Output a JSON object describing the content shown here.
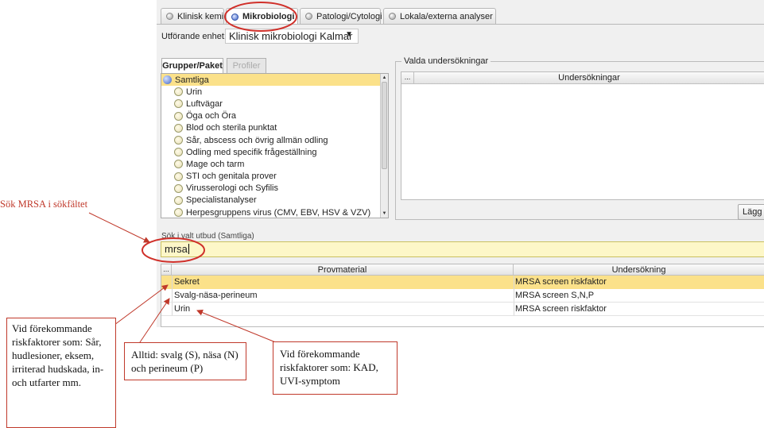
{
  "tabs": [
    {
      "label": "Klinisk kemi",
      "active": false
    },
    {
      "label": "Mikrobiologi",
      "active": true
    },
    {
      "label": "Patologi/Cytologi",
      "active": false
    },
    {
      "label": "Lokala/externa analyser",
      "active": false
    }
  ],
  "unit": {
    "label": "Utförande enhet:",
    "value": "Klinisk mikrobiologi Kalmar"
  },
  "groups_panel": {
    "tab_groups": "Grupper/Paket",
    "tab_profiles": "Profiler",
    "items": [
      "Samtliga",
      "Urin",
      "Luftvägar",
      "Öga och Öra",
      "Blod och sterila punktat",
      "Sår, abscess och övrig allmän odling",
      "Odling med specifik frågeställning",
      "Mage och tarm",
      "STI och genitala prover",
      "Virusserologi och Syfilis",
      "Specialistanalyser",
      "Herpesgruppens virus (CMV, EBV, HSV & VZV)"
    ]
  },
  "selected_panel": {
    "title": "Valda undersökningar",
    "dots": "...",
    "column": "Undersökningar",
    "add_button": "Lägg till"
  },
  "search": {
    "label": "Sök i valt utbud (Samtliga)",
    "value": "mrsa"
  },
  "results": {
    "dots": "...",
    "columns": [
      "Provmaterial",
      "Undersökning"
    ],
    "rows": [
      {
        "material": "Sekret",
        "test": "MRSA screen riskfaktor"
      },
      {
        "material": "Svalg-näsa-perineum",
        "test": "MRSA screen S,N,P"
      },
      {
        "material": "Urin",
        "test": "MRSA screen riskfaktor"
      }
    ]
  },
  "annotations": {
    "search_hint": "Sök MRSA i sökfältet",
    "callout_left": "Vid förekommande riskfaktorer som: Sår, hudlesioner, eksem, irriterad hudskada, in- och utfarter mm.",
    "callout_middle": "Alltid: svalg (S), näsa (N) och perineum (P)",
    "callout_right": "Vid förekommande riskfaktorer som: KAD, UVI-symptom"
  },
  "colors": {
    "highlight": "#fbe18a",
    "search_bg": "#fdf7c8",
    "annotation_red": "#c0392b"
  }
}
